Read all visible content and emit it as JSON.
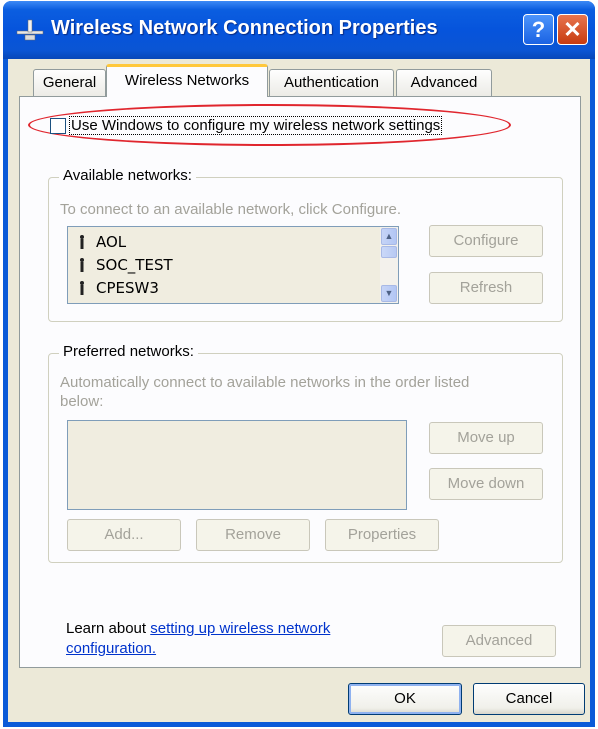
{
  "window": {
    "title": "Wireless Network Connection Properties",
    "help_label": "?",
    "close_label": "✕"
  },
  "tabs": [
    {
      "label": "General"
    },
    {
      "label": "Wireless Networks"
    },
    {
      "label": "Authentication"
    },
    {
      "label": "Advanced"
    }
  ],
  "use_windows": {
    "label": "Use Windows to configure my wireless network settings",
    "checked": false
  },
  "available": {
    "legend": "Available networks:",
    "instruction": "To connect to an available network, click Configure.",
    "networks": [
      "AOL",
      "SOC_TEST",
      "CPESW3"
    ],
    "configure_label": "Configure",
    "refresh_label": "Refresh"
  },
  "preferred": {
    "legend": "Preferred networks:",
    "instruction_line1": "Automatically connect to available networks in the order listed",
    "instruction_line2": "below:",
    "move_up_label": "Move up",
    "move_down_label": "Move down",
    "add_label": "Add...",
    "remove_label": "Remove",
    "properties_label": "Properties"
  },
  "learn": {
    "prefix": "Learn about ",
    "link_text_line1": "setting up wireless network",
    "link_text_line2": "configuration.",
    "advanced_label": "Advanced"
  },
  "footer": {
    "ok_label": "OK",
    "cancel_label": "Cancel"
  },
  "colors": {
    "titlebar": "#0654dc",
    "highlight_oval": "#e0262e",
    "active_tab_accent": "#ffc83c",
    "link": "#0033cc"
  }
}
